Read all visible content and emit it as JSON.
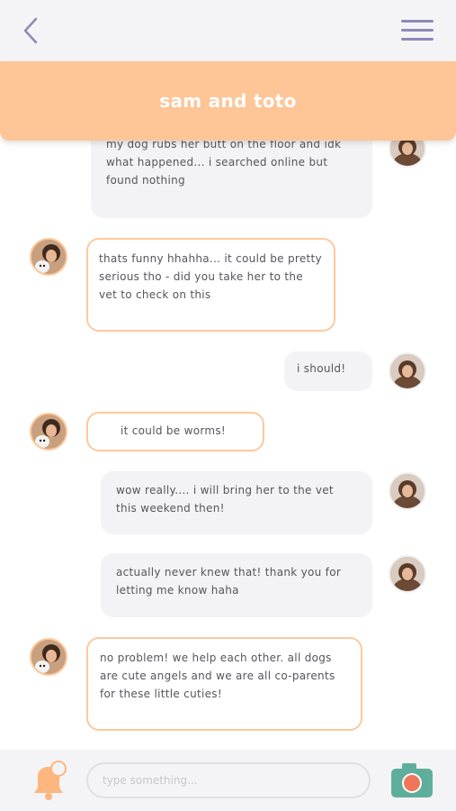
{
  "header": {
    "back_icon": "chevron-left-icon",
    "menu_icon": "hamburger-menu-icon",
    "title": "sam and toto"
  },
  "messages": [
    {
      "from": "user",
      "text": "my dog rubs her butt on the floor and idk what happened... i searched online but found nothing"
    },
    {
      "from": "friend",
      "text": "thats funny hhahha... it could be pretty serious tho - did you take her to the vet to check on this"
    },
    {
      "from": "user",
      "text": "i should!"
    },
    {
      "from": "friend",
      "text": "it could be worms!"
    },
    {
      "from": "user",
      "text": "wow really.... i will bring her to the vet this weekend then!"
    },
    {
      "from": "user",
      "text": "actually never knew that! thank you for letting me know haha"
    },
    {
      "from": "friend",
      "text": "no problem! we help each other. all dogs are cute angels and we are all co-parents for these little cuties!"
    }
  ],
  "footer": {
    "notification_icon": "bell-icon",
    "input_placeholder": "type something...",
    "camera_icon": "camera-icon"
  },
  "colors": {
    "accent": "#fec597",
    "bubble_border": "#ffc99c",
    "sent_bubble": "#f3f3f5",
    "menu_icon": "#8e89b6",
    "camera": "#5fae9c"
  }
}
